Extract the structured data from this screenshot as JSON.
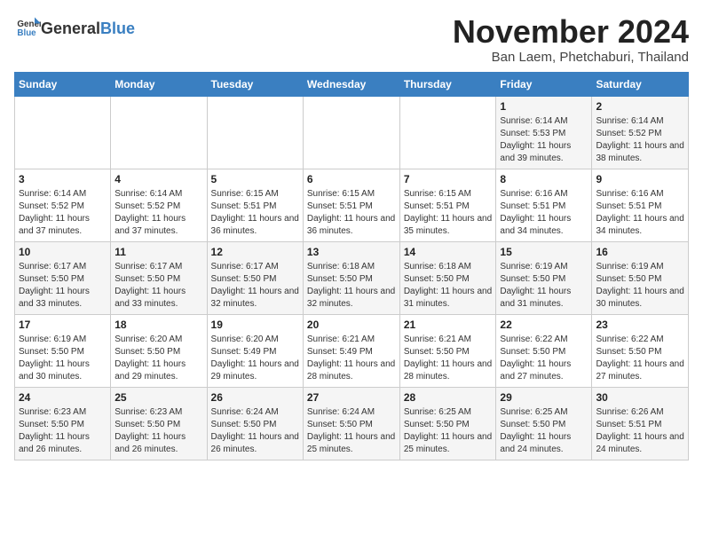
{
  "logo": {
    "general": "General",
    "blue": "Blue"
  },
  "title": "November 2024",
  "location": "Ban Laem, Phetchaburi, Thailand",
  "headers": [
    "Sunday",
    "Monday",
    "Tuesday",
    "Wednesday",
    "Thursday",
    "Friday",
    "Saturday"
  ],
  "weeks": [
    [
      {
        "day": "",
        "content": ""
      },
      {
        "day": "",
        "content": ""
      },
      {
        "day": "",
        "content": ""
      },
      {
        "day": "",
        "content": ""
      },
      {
        "day": "",
        "content": ""
      },
      {
        "day": "1",
        "content": "Sunrise: 6:14 AM\nSunset: 5:53 PM\nDaylight: 11 hours and 39 minutes."
      },
      {
        "day": "2",
        "content": "Sunrise: 6:14 AM\nSunset: 5:52 PM\nDaylight: 11 hours and 38 minutes."
      }
    ],
    [
      {
        "day": "3",
        "content": "Sunrise: 6:14 AM\nSunset: 5:52 PM\nDaylight: 11 hours and 37 minutes."
      },
      {
        "day": "4",
        "content": "Sunrise: 6:14 AM\nSunset: 5:52 PM\nDaylight: 11 hours and 37 minutes."
      },
      {
        "day": "5",
        "content": "Sunrise: 6:15 AM\nSunset: 5:51 PM\nDaylight: 11 hours and 36 minutes."
      },
      {
        "day": "6",
        "content": "Sunrise: 6:15 AM\nSunset: 5:51 PM\nDaylight: 11 hours and 36 minutes."
      },
      {
        "day": "7",
        "content": "Sunrise: 6:15 AM\nSunset: 5:51 PM\nDaylight: 11 hours and 35 minutes."
      },
      {
        "day": "8",
        "content": "Sunrise: 6:16 AM\nSunset: 5:51 PM\nDaylight: 11 hours and 34 minutes."
      },
      {
        "day": "9",
        "content": "Sunrise: 6:16 AM\nSunset: 5:51 PM\nDaylight: 11 hours and 34 minutes."
      }
    ],
    [
      {
        "day": "10",
        "content": "Sunrise: 6:17 AM\nSunset: 5:50 PM\nDaylight: 11 hours and 33 minutes."
      },
      {
        "day": "11",
        "content": "Sunrise: 6:17 AM\nSunset: 5:50 PM\nDaylight: 11 hours and 33 minutes."
      },
      {
        "day": "12",
        "content": "Sunrise: 6:17 AM\nSunset: 5:50 PM\nDaylight: 11 hours and 32 minutes."
      },
      {
        "day": "13",
        "content": "Sunrise: 6:18 AM\nSunset: 5:50 PM\nDaylight: 11 hours and 32 minutes."
      },
      {
        "day": "14",
        "content": "Sunrise: 6:18 AM\nSunset: 5:50 PM\nDaylight: 11 hours and 31 minutes."
      },
      {
        "day": "15",
        "content": "Sunrise: 6:19 AM\nSunset: 5:50 PM\nDaylight: 11 hours and 31 minutes."
      },
      {
        "day": "16",
        "content": "Sunrise: 6:19 AM\nSunset: 5:50 PM\nDaylight: 11 hours and 30 minutes."
      }
    ],
    [
      {
        "day": "17",
        "content": "Sunrise: 6:19 AM\nSunset: 5:50 PM\nDaylight: 11 hours and 30 minutes."
      },
      {
        "day": "18",
        "content": "Sunrise: 6:20 AM\nSunset: 5:50 PM\nDaylight: 11 hours and 29 minutes."
      },
      {
        "day": "19",
        "content": "Sunrise: 6:20 AM\nSunset: 5:49 PM\nDaylight: 11 hours and 29 minutes."
      },
      {
        "day": "20",
        "content": "Sunrise: 6:21 AM\nSunset: 5:49 PM\nDaylight: 11 hours and 28 minutes."
      },
      {
        "day": "21",
        "content": "Sunrise: 6:21 AM\nSunset: 5:50 PM\nDaylight: 11 hours and 28 minutes."
      },
      {
        "day": "22",
        "content": "Sunrise: 6:22 AM\nSunset: 5:50 PM\nDaylight: 11 hours and 27 minutes."
      },
      {
        "day": "23",
        "content": "Sunrise: 6:22 AM\nSunset: 5:50 PM\nDaylight: 11 hours and 27 minutes."
      }
    ],
    [
      {
        "day": "24",
        "content": "Sunrise: 6:23 AM\nSunset: 5:50 PM\nDaylight: 11 hours and 26 minutes."
      },
      {
        "day": "25",
        "content": "Sunrise: 6:23 AM\nSunset: 5:50 PM\nDaylight: 11 hours and 26 minutes."
      },
      {
        "day": "26",
        "content": "Sunrise: 6:24 AM\nSunset: 5:50 PM\nDaylight: 11 hours and 26 minutes."
      },
      {
        "day": "27",
        "content": "Sunrise: 6:24 AM\nSunset: 5:50 PM\nDaylight: 11 hours and 25 minutes."
      },
      {
        "day": "28",
        "content": "Sunrise: 6:25 AM\nSunset: 5:50 PM\nDaylight: 11 hours and 25 minutes."
      },
      {
        "day": "29",
        "content": "Sunrise: 6:25 AM\nSunset: 5:50 PM\nDaylight: 11 hours and 24 minutes."
      },
      {
        "day": "30",
        "content": "Sunrise: 6:26 AM\nSunset: 5:51 PM\nDaylight: 11 hours and 24 minutes."
      }
    ]
  ]
}
